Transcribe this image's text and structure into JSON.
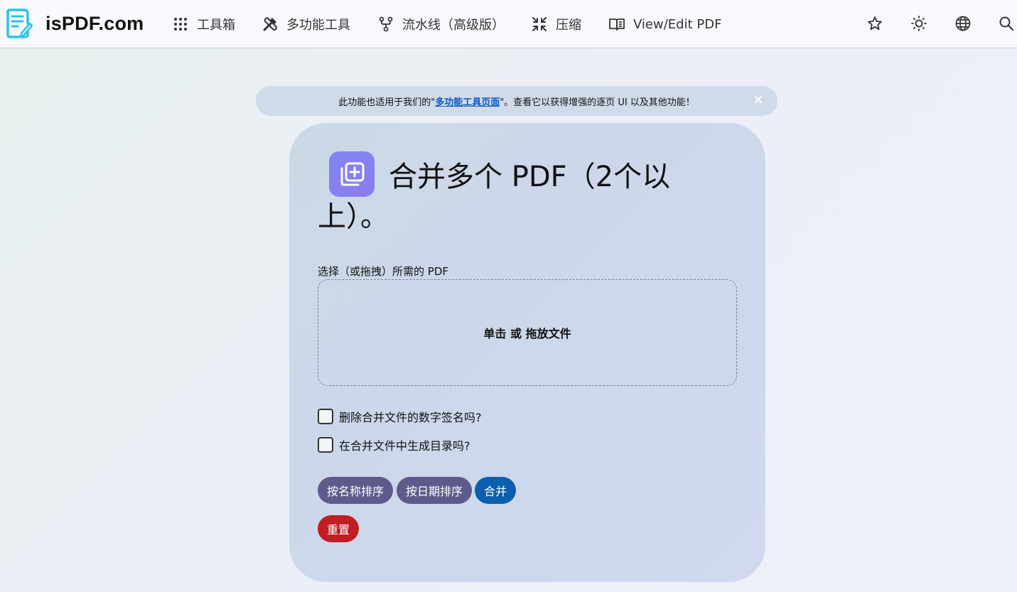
{
  "brand": {
    "name": "isPDF.com",
    "logo_icon": "document-edit-icon",
    "accent": "#31bde8"
  },
  "nav": {
    "items": [
      {
        "label": "工具箱",
        "icon": "grid-dots-icon"
      },
      {
        "label": "多功能工具",
        "icon": "tools-icon"
      },
      {
        "label": "流水线（高级版）",
        "icon": "pipeline-icon"
      },
      {
        "label": "压缩",
        "icon": "compress-icon"
      },
      {
        "label": "View/Edit PDF",
        "icon": "book-open-icon"
      }
    ],
    "right_icons": [
      "star-icon",
      "sun-icon",
      "globe-icon",
      "search-icon"
    ]
  },
  "banner": {
    "text_before": "此功能也适用于我们的\"",
    "link": "多功能工具页面",
    "text_after": "\"。查看它以获得增强的逐页 UI 以及其他功能！",
    "close_icon": "close-icon"
  },
  "card": {
    "title": "合并多个 PDF（2个以上）。",
    "title_icon": "add-stack-icon",
    "file_label": "选择（或拖拽）所需的 PDF",
    "dropzone_text": "单击 或 拖放文件",
    "options": [
      {
        "label": "删除合并文件的数字签名吗?",
        "checked": false
      },
      {
        "label": "在合并文件中生成目录吗?",
        "checked": false
      }
    ],
    "buttons": {
      "sort_name": "按名称排序",
      "sort_date": "按日期排序",
      "merge": "合并",
      "reset": "重置"
    }
  },
  "colors": {
    "primary": "#0b5fae",
    "sort_button": "#5e5b8c",
    "danger": "#c01d24",
    "title_icon": "#8080f2"
  }
}
